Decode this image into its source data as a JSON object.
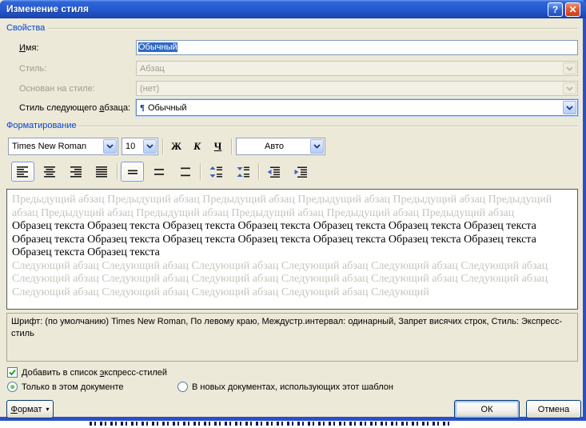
{
  "window": {
    "title": "Изменение стиля",
    "help": "?",
    "close": "✕"
  },
  "properties": {
    "section": "Свойства",
    "name_label_accel": "И",
    "name_label_rest": "мя:",
    "name_value": "Обычный",
    "style_label": "Стиль:",
    "style_value": "Абзац",
    "based_label": "Основан на стиле:",
    "based_value": "(нет)",
    "next_label_pre": "Стиль следующего ",
    "next_label_accel": "а",
    "next_label_rest": "бзаца:",
    "next_pilcrow": "¶",
    "next_value": "Обычный"
  },
  "formatting": {
    "section": "Форматирование",
    "font_name": "Times New Roman",
    "font_size": "10",
    "bold": "Ж",
    "italic": "К",
    "underline": "Ч",
    "color": "Авто"
  },
  "preview": {
    "previous": "Предыдущий абзац Предыдущий абзац Предыдущий абзац Предыдущий абзац Предыдущий абзац Предыдущий абзац Предыдущий абзац Предыдущий абзац Предыдущий абзац Предыдущий абзац Предыдущий абзац",
    "sample": "Образец текста Образец текста Образец текста Образец текста Образец текста Образец текста Образец текста Образец текста Образец текста Образец текста Образец текста Образец текста Образец текста Образец текста Образец текста Образец текста",
    "next": "Следующий абзац Следующий абзац Следующий абзац Следующий абзац Следующий абзац Следующий абзац Следующий абзац Следующий абзац Следующий абзац Следующий абзац Следующий абзац Следующий абзац Следующий абзац Следующий абзац Следующий абзац Следующий абзац Следующий"
  },
  "description": "Шрифт: (по умолчанию) Times New Roman, По левому краю, Междустр.интервал:  одинарный, Запрет висячих строк, Стиль: Экспресс-стиль",
  "options": {
    "quick_pre": "Добавить в список ",
    "quick_accel": "э",
    "quick_rest": "кспресс-стилей",
    "only_doc": "Только в этом документе",
    "new_docs": "В новых документах, использующих этот шаблон"
  },
  "footer": {
    "format_accel": "Ф",
    "format_rest": "ормат",
    "format_arrow": "▾",
    "ok": "ОК",
    "cancel": "Отмена"
  },
  "colors": {
    "titlebar_blue": "#2458cc",
    "accent_blue": "#0046d5",
    "selection_blue": "#316ac5",
    "check_green": "#21a121",
    "window_border": "#2a50c8",
    "dialog_bg": "#ece9d8"
  }
}
